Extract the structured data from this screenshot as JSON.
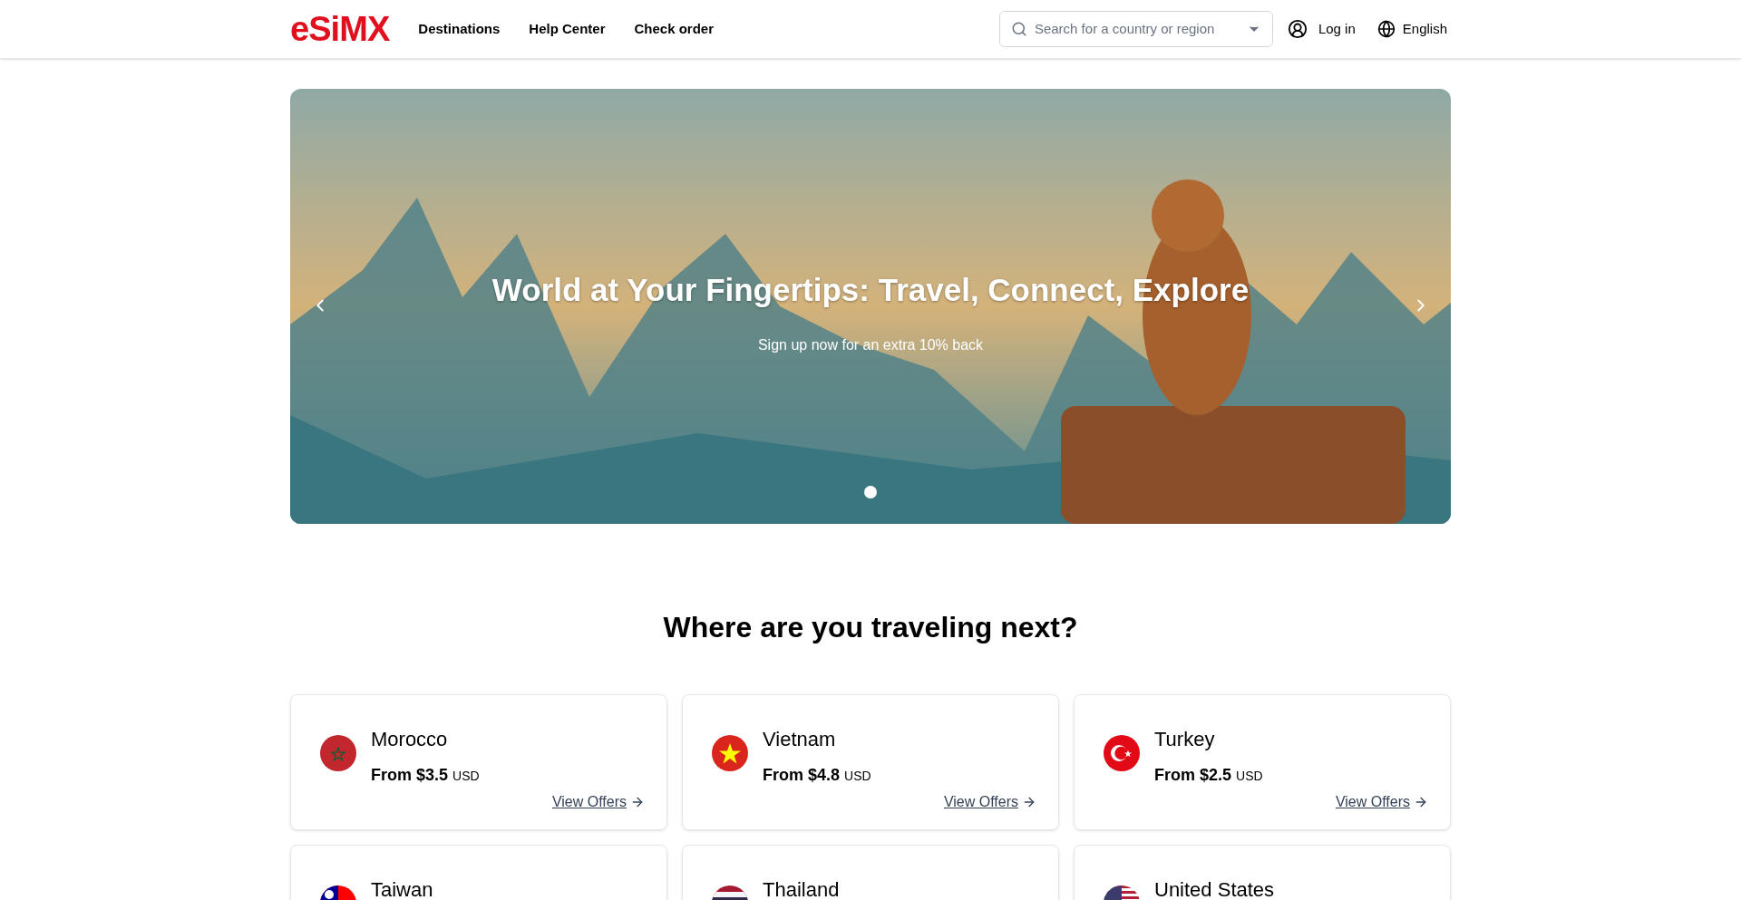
{
  "header": {
    "logo": "eSiMX",
    "nav": [
      "Destinations",
      "Help Center",
      "Check order"
    ],
    "search": {
      "placeholder": "Search for a country or region"
    },
    "login": "Log in",
    "language": "English"
  },
  "hero": {
    "title": "World at Your Fingertips: Travel, Connect, Explore",
    "subtitle": "Sign up now for an extra 10% back",
    "dots": [
      {
        "selected": true
      }
    ]
  },
  "section": {
    "title": "Where are you traveling next?"
  },
  "destinations": [
    {
      "name": "Morocco",
      "kind": "morocco",
      "from": "From",
      "price": "$3.5",
      "currency": "USD",
      "link": "View Offers"
    },
    {
      "name": "Vietnam",
      "kind": "vietnam",
      "from": "From",
      "price": "$4.8",
      "currency": "USD",
      "link": "View Offers"
    },
    {
      "name": "Turkey",
      "kind": "turkey",
      "from": "From",
      "price": "$2.5",
      "currency": "USD",
      "link": "View Offers"
    },
    {
      "name": "Taiwan",
      "kind": "taiwan"
    },
    {
      "name": "Thailand",
      "kind": "thailand"
    },
    {
      "name": "United States",
      "kind": "usa"
    }
  ]
}
